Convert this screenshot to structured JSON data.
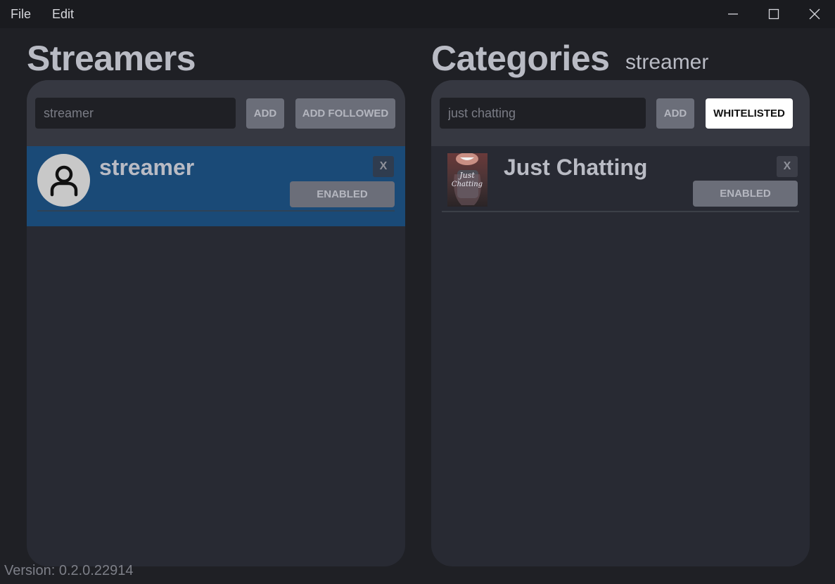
{
  "menu": {
    "file": "File",
    "edit": "Edit"
  },
  "window_controls": [
    "minimize-icon",
    "maximize-icon",
    "close-icon"
  ],
  "streamers": {
    "title": "Streamers",
    "search_value": "",
    "search_placeholder": "streamer",
    "add_label": "ADD",
    "add_followed_label": "ADD FOLLOWED",
    "items": [
      {
        "name": "streamer",
        "status": "ENABLED",
        "remove_label": "X",
        "icon": "user-icon",
        "selected": true
      }
    ]
  },
  "categories": {
    "title": "Categories",
    "context": "streamer",
    "search_value": "",
    "search_placeholder": "just chatting",
    "add_label": "ADD",
    "mode_label": "WHITELISTED",
    "items": [
      {
        "name": "Just Chatting",
        "status": "ENABLED",
        "remove_label": "X",
        "thumb_text": "Just Chatting"
      }
    ]
  },
  "version": "Version: 0.2.0.22914",
  "colors": {
    "background": "#1f2025",
    "panel": "#282a33",
    "panel_header": "#363841",
    "selected_row": "#1a4a77",
    "button": "#6b6e79",
    "text": "#b9bbc4"
  }
}
